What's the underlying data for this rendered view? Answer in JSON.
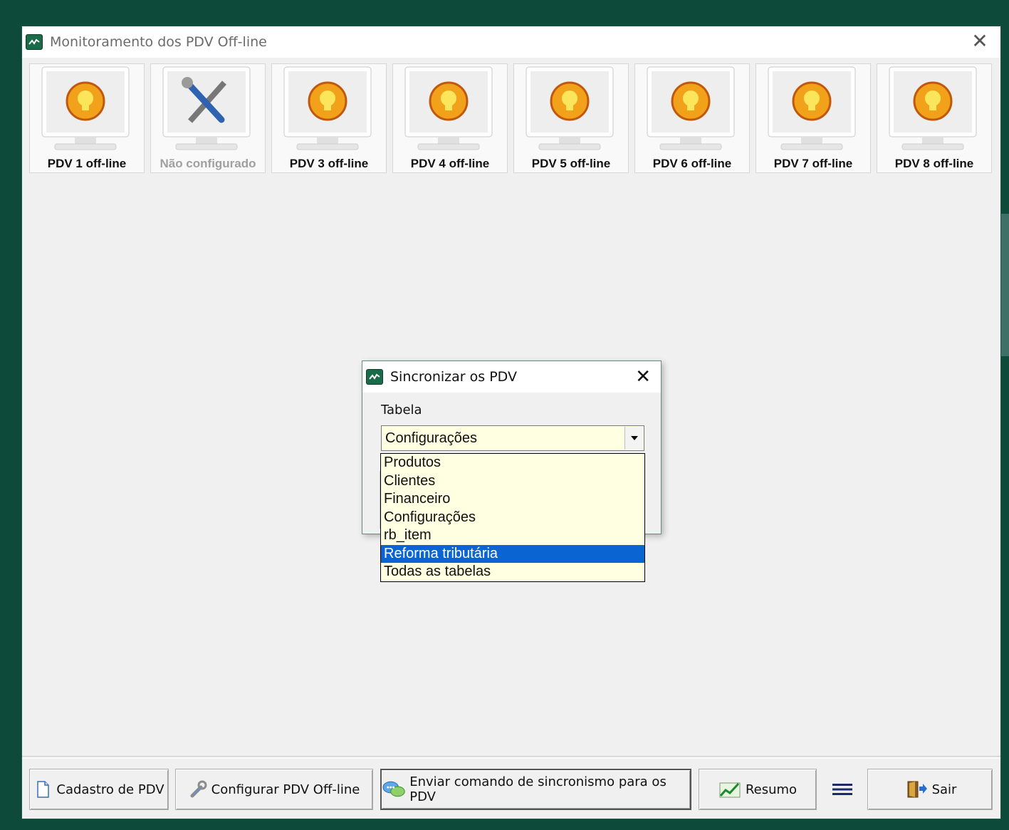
{
  "window": {
    "title": "Monitoramento dos PDV Off-line",
    "close_symbol": "✕"
  },
  "pdvs": [
    {
      "label": "PDV 1 off-line",
      "status": "offline",
      "icon": "monitor-bulb-icon"
    },
    {
      "label": "Não configurado",
      "status": "not-configured",
      "icon": "monitor-tools-icon"
    },
    {
      "label": "PDV 3 off-line",
      "status": "offline",
      "icon": "monitor-bulb-icon"
    },
    {
      "label": "PDV 4 off-line",
      "status": "offline",
      "icon": "monitor-bulb-icon"
    },
    {
      "label": "PDV 5 off-line",
      "status": "offline",
      "icon": "monitor-bulb-icon"
    },
    {
      "label": "PDV 6 off-line",
      "status": "offline",
      "icon": "monitor-bulb-icon"
    },
    {
      "label": "PDV 7 off-line",
      "status": "offline",
      "icon": "monitor-bulb-icon"
    },
    {
      "label": "PDV 8 off-line",
      "status": "offline",
      "icon": "monitor-bulb-icon"
    }
  ],
  "footer": {
    "cadastro_label": "Cadastro de PDV",
    "configurar_label": "Configurar PDV Off-line",
    "enviar_label": "Enviar comando de sincronismo para os PDV",
    "resumo_label": "Resumo",
    "sair_label": "Sair"
  },
  "dialog": {
    "title": "Sincronizar os PDV",
    "close_symbol": "✕",
    "field_label": "Tabela",
    "selected_value": "Configurações",
    "options": [
      {
        "label": "Produtos",
        "highlighted": false
      },
      {
        "label": "Clientes",
        "highlighted": false
      },
      {
        "label": "Financeiro",
        "highlighted": false
      },
      {
        "label": "Configurações",
        "highlighted": false
      },
      {
        "label": "rb_item",
        "highlighted": false
      },
      {
        "label": "Reforma tributária",
        "highlighted": true
      },
      {
        "label": "Todas as tabelas",
        "highlighted": false
      }
    ]
  },
  "colors": {
    "desktop": "#0d4a3a",
    "window_bg": "#f0f0f0",
    "combo_bg": "#ffffe1",
    "highlight": "#0a64d2",
    "bulb_orange": "#f2a21a",
    "bulb_yellow": "#fbe55a"
  }
}
